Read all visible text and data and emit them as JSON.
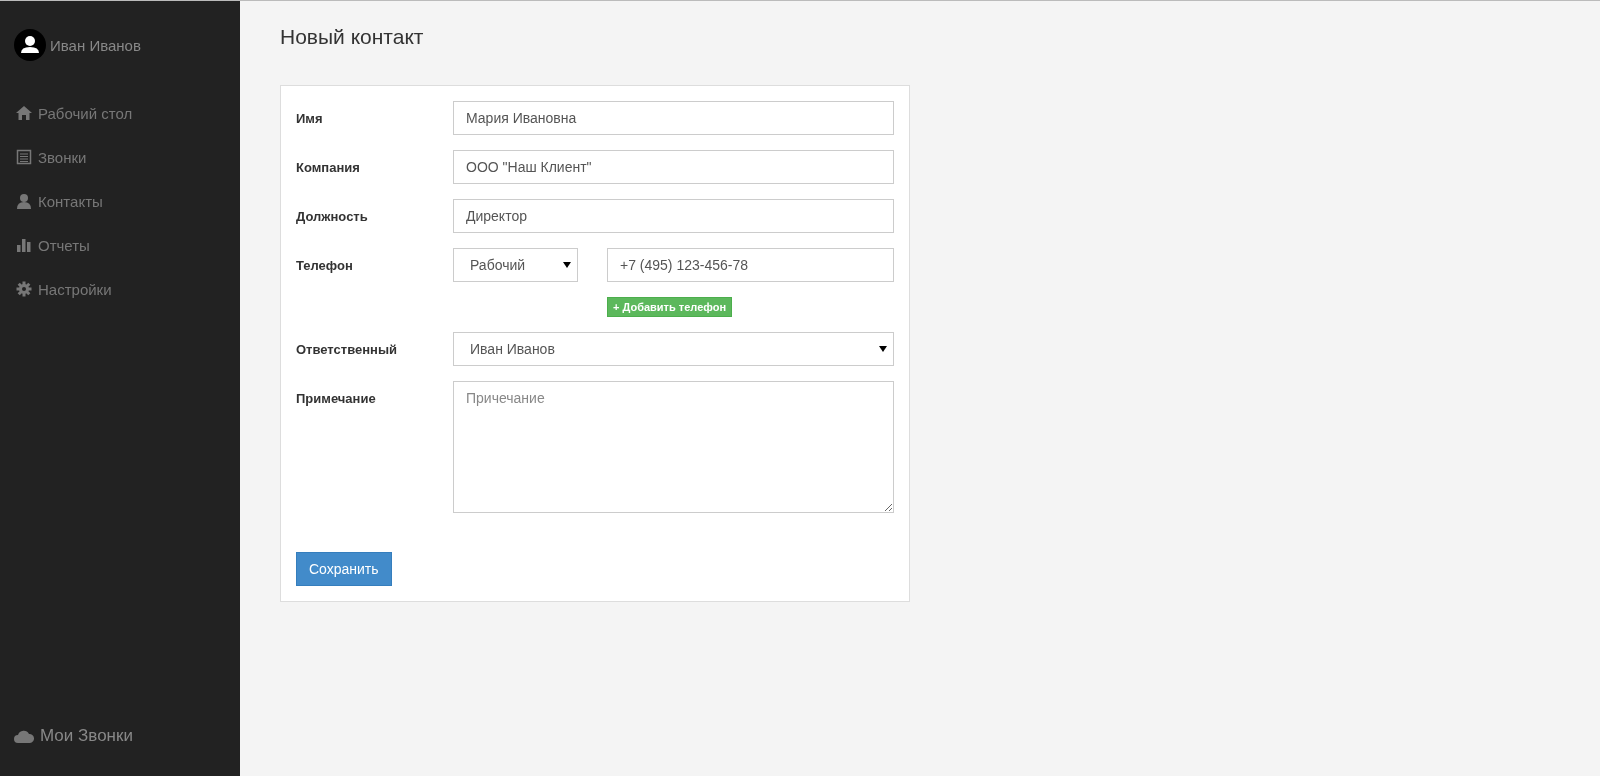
{
  "sidebar": {
    "user": {
      "name": "Иван Иванов"
    },
    "items": [
      {
        "label": "Рабочий стол",
        "kind": "home"
      },
      {
        "label": "Звонки",
        "kind": "list"
      },
      {
        "label": "Контакты",
        "kind": "person"
      },
      {
        "label": "Отчеты",
        "kind": "chart"
      },
      {
        "label": "Настройки",
        "kind": "gear"
      }
    ],
    "brand": "Мои Звонки"
  },
  "page": {
    "title": "Новый контакт"
  },
  "form": {
    "fields": [
      {
        "kind": "text",
        "label": "Имя",
        "value": "Мария Ивановна"
      },
      {
        "kind": "text",
        "label": "Компания",
        "value": "ООО \"Наш Клиент\""
      },
      {
        "kind": "text",
        "label": "Должность",
        "value": "Директор"
      },
      {
        "kind": "phone",
        "label": "Телефон",
        "type": "Рабочий",
        "value": "+7 (495) 123-456-78",
        "add_button": "+ Добавить телефон"
      },
      {
        "kind": "select",
        "label": "Ответственный",
        "value": "Иван Иванов"
      },
      {
        "kind": "textarea",
        "label": "Примечание",
        "placeholder": "Причечание"
      }
    ],
    "submit": "Сохранить"
  }
}
